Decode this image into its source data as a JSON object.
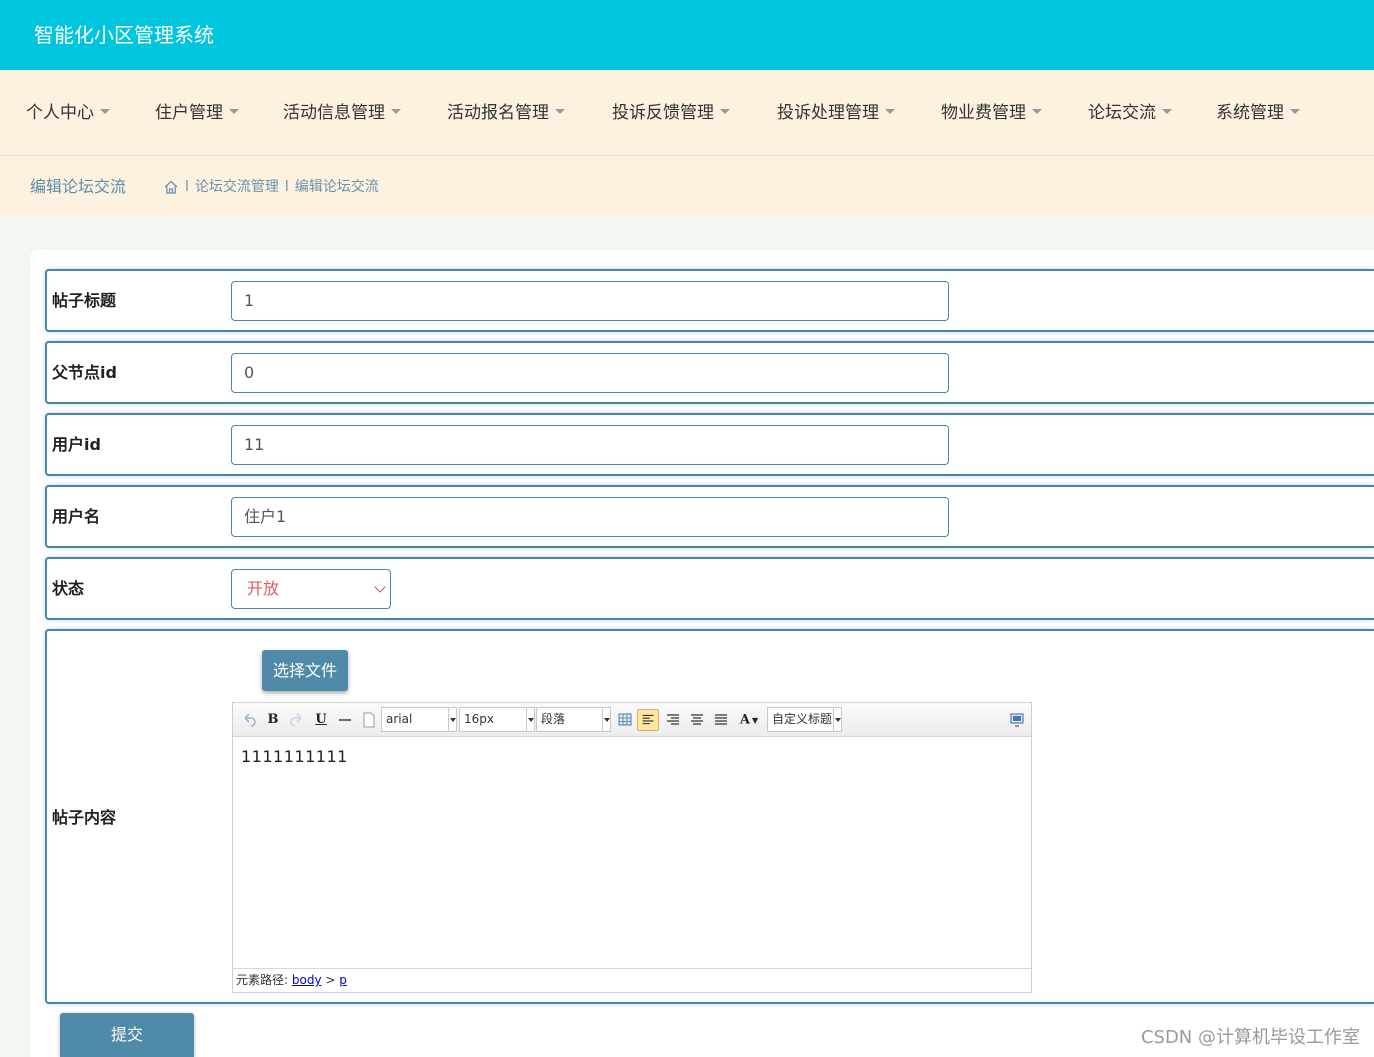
{
  "header": {
    "title": "智能化小区管理系统"
  },
  "nav": {
    "items": [
      {
        "label": "个人中心"
      },
      {
        "label": "住户管理"
      },
      {
        "label": "活动信息管理"
      },
      {
        "label": "活动报名管理"
      },
      {
        "label": "投诉反馈管理"
      },
      {
        "label": "投诉处理管理"
      },
      {
        "label": "物业费管理"
      },
      {
        "label": "论坛交流"
      },
      {
        "label": "系统管理"
      }
    ]
  },
  "subheader": {
    "title": "编辑论坛交流",
    "breadcrumb": [
      "论坛交流管理",
      "编辑论坛交流"
    ],
    "separator": "l"
  },
  "form": {
    "post_title": {
      "label": "帖子标题",
      "value": "1"
    },
    "parent_id": {
      "label": "父节点id",
      "value": "0"
    },
    "user_id": {
      "label": "用户id",
      "value": "11"
    },
    "username": {
      "label": "用户名",
      "value": "住户1"
    },
    "status": {
      "label": "状态",
      "value": "开放"
    },
    "content": {
      "label": "帖子内容",
      "file_button": "选择文件",
      "toolbar": {
        "font_family": "arial",
        "font_size": "16px",
        "paragraph": "段落",
        "custom_heading": "自定义标题"
      },
      "body": "1111111111",
      "status_prefix": "元素路径:",
      "path_body": "body",
      "path_sep": ">",
      "path_p": "p"
    },
    "submit": "提交"
  },
  "watermark": "CSDN @计算机毕设工作室",
  "colors": {
    "header_bg": "#00c5de",
    "nav_bg": "#fdf1e0",
    "accent": "#4f8aa8",
    "status_text": "#e05b5b"
  }
}
